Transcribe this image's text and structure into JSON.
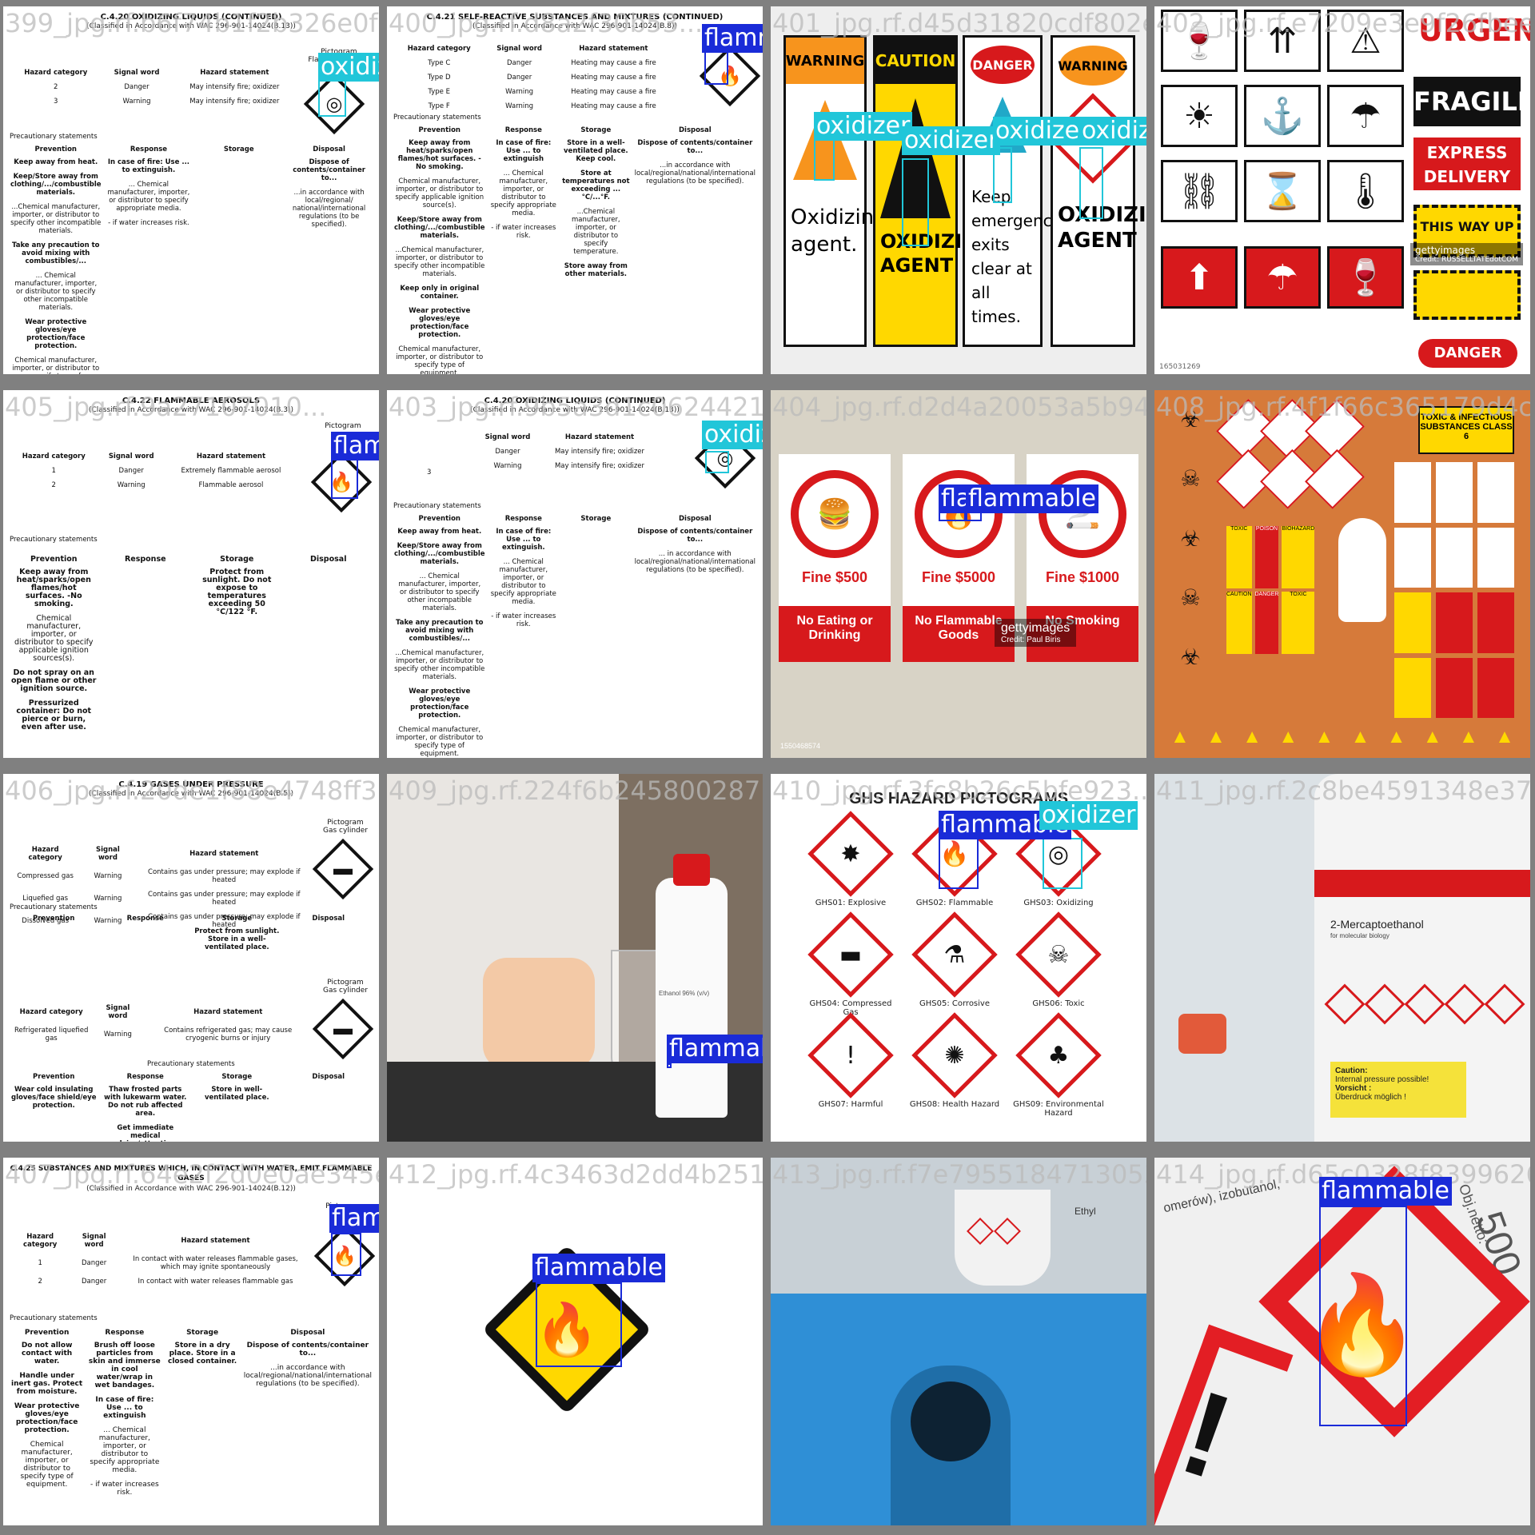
{
  "labels": {
    "flammable": "flammable",
    "oxidizer": "oxidizer"
  },
  "colors": {
    "flammable_box": "#1a2bd8",
    "oxidizer_box": "#21c6d9",
    "background": "#808080"
  },
  "tiles": {
    "t1": {
      "fname": "399_jpg.rf.b6f74b1f2b326e0f0e...",
      "title": "C.4.20 OXIDIZING LIQUIDS (CONTINUED)",
      "subtitle": "(Classified in Accordance with WAC 296-901-14024(B.13))",
      "headers": [
        "Hazard category",
        "Signal word",
        "Hazard statement"
      ],
      "rows": [
        [
          "2",
          "Danger",
          "May intensify fire; oxidizer"
        ],
        [
          "3",
          "Warning",
          "May intensify fire; oxidizer"
        ]
      ],
      "precaution_label": "Precautionary statements",
      "col_heads": [
        "Prevention",
        "Response",
        "Storage",
        "Disposal"
      ],
      "prevention": [
        "Keep away from heat.",
        "Keep/Store away from clothing/.../combustible materials.",
        "...Chemical manufacturer, importer, or distributor to specify other incompatible materials.",
        "Take any precaution to avoid mixing with combustibles/...",
        "... Chemical manufacturer, importer, or distributor to specify other incompatible materials.",
        "Wear protective gloves/eye protection/face protection.",
        "Chemical manufacturer, importer, or distributor to specify type of equipment."
      ],
      "response": [
        "In case of fire: Use ... to extinguish.",
        "... Chemical manufacturer, importer, or distributor to specify appropriate media.",
        "- if water increases risk."
      ],
      "disposal": [
        "Dispose of contents/container to...",
        "...in accordance with local/regional/ national/international regulations (to be specified)."
      ],
      "picto": "Pictogram",
      "picto_sub": "Flame over circle"
    },
    "t2": {
      "fname": "400_jpg.rf.d8a2f30b53...",
      "title": "C.4.21 SELF-REACTIVE SUBSTANCES AND MIXTURES (CONTINUED)",
      "subtitle": "(Classified in Accordance with WAC 296-901-14024(B.8))",
      "headers": [
        "Hazard category",
        "Signal word",
        "Hazard statement"
      ],
      "rows": [
        [
          "Type C",
          "Danger",
          "Heating may cause a fire"
        ],
        [
          "Type D",
          "Danger",
          "Heating may cause a fire"
        ],
        [
          "Type E",
          "Warning",
          "Heating may cause a fire"
        ],
        [
          "Type F",
          "Warning",
          "Heating may cause a fire"
        ]
      ],
      "precaution_label": "Precautionary statements",
      "col_heads": [
        "Prevention",
        "Response",
        "Storage",
        "Disposal"
      ],
      "prevention": [
        "Keep away from heat/sparks/open flames/hot surfaces. - No smoking.",
        "Chemical manufacturer, importer, or distributor to specify applicable ignition source(s).",
        "Keep/Store away from clothing/.../combustible materials.",
        "...Chemical manufacturer, importer, or distributor to specify other incompatible materials.",
        "Keep only in original container.",
        "Wear protective gloves/eye protection/face protection.",
        "Chemical manufacturer, importer, or distributor to specify type of equipment."
      ],
      "response": [
        "In case of fire: Use ... to extinguish",
        "... Chemical manufacturer, importer, or distributor to specify appropriate media.",
        "- if water increases risk."
      ],
      "storage": [
        "Store in a well-ventilated place. Keep cool.",
        "Store at temperatures not exceeding ...°C/...°F.",
        "...Chemical manufacturer, importer, or distributor to specify temperature.",
        "Store away from other materials."
      ],
      "disposal": [
        "Dispose of contents/container to...",
        "...in accordance with local/regional/national/international regulations (to be specified)."
      ]
    },
    "t3": {
      "fname": "401_jpg.rf.d45d31820cdf802e5708...",
      "signs": [
        {
          "header": "WARNING",
          "body": "Oxidizing agent."
        },
        {
          "header": "CAUTION",
          "body": "OXIDIZING AGENT"
        },
        {
          "header": "DANGER",
          "body": "Keep emergency exits clear at all times."
        },
        {
          "header": "WARNING",
          "body": "OXIDIZING AGENT"
        }
      ]
    },
    "t4": {
      "fname": "402_jpg.rf.e7209e3e9f26fbeefc3...",
      "words": [
        "URGENT",
        "FRAGILE",
        "EXPRESS DELIVERY",
        "THIS WAY UP",
        "DANGER",
        "THIS WAY UP"
      ],
      "watermark": "gettyimages",
      "credit": "Credit: RUSSELLTATEdotCOM",
      "stock_id": "165031269"
    },
    "t5": {
      "fname": "405_jpg.rf.9a27107010...",
      "title": "C.4.22 FLAMMABLE AEROSOLS",
      "subtitle": "(Classified in Accordance with WAC 296-901-14024(B.3))",
      "headers": [
        "Hazard category",
        "Signal word",
        "Hazard statement"
      ],
      "rows": [
        [
          "1",
          "Danger",
          "Extremely flammable aerosol"
        ],
        [
          "2",
          "Warning",
          "Flammable aerosol"
        ]
      ],
      "picto": "Pictogram",
      "precaution_label": "Precautionary statements",
      "col_heads": [
        "Prevention",
        "Response",
        "Storage",
        "Disposal"
      ],
      "prevention": [
        "Keep away from heat/sparks/open flames/hot surfaces. -No smoking.",
        "Chemical manufacturer, importer, or distributor to specify applicable ignition sources(s).",
        "Do not spray on an open flame or other ignition source.",
        "Pressurized container: Do not pierce or burn, even after use."
      ],
      "storage": [
        "Protect from sunlight. Do not expose to temperatures exceeding 50 °C/122 °F."
      ]
    },
    "t6": {
      "fname": "403_jpg.rf.9b5a3d1c0624421c2...",
      "title": "C.4.20 OXIDIZING LIQUIDS (CONTINUED)",
      "subtitle": "(Classified in Accordance with WAC 296-901-14024(B.13))",
      "headers": [
        "Signal word",
        "Hazard statement"
      ],
      "rows": [
        [
          "Danger",
          "May intensify fire; oxidizer"
        ],
        [
          "Warning",
          "May intensify fire; oxidizer"
        ]
      ],
      "row_cat": "3",
      "precaution_label": "Precautionary statements",
      "col_heads": [
        "Prevention",
        "Response",
        "Storage",
        "Disposal"
      ],
      "prevention": [
        "Keep away from heat.",
        "Keep/Store away from clothing/.../combustible materials.",
        "... Chemical manufacturer, importer, or distributor to specify other incompatible materials.",
        "Take any precaution to avoid mixing with combustibles/...",
        "...Chemical manufacturer, importer, or distributor to specify other incompatible materials.",
        "Wear protective gloves/eye protection/face protection.",
        "Chemical manufacturer, importer, or distributor to specify type of equipment."
      ],
      "response": [
        "In case of fire: Use ... to extinguish.",
        "... Chemical manufacturer, importer, or distributor to specify appropriate media.",
        "- if water increases risk."
      ],
      "disposal": [
        "Dispose of contents/container to...",
        "... in accordance with local/regional/national/international regulations (to be specified)."
      ]
    },
    "t7": {
      "fname": "404_jpg.rf.d2d4a20053a5b94c5b0...",
      "fines": [
        "Fine $500",
        "Fine $5000",
        "Fine $1000"
      ],
      "notices": [
        "No Eating or Drinking",
        "No Flammable Goods",
        "No Smoking"
      ],
      "watermark": "gettyimages",
      "credit": "Credit: Paul Biris",
      "stock_id": "1550468574"
    },
    "t8": {
      "fname": "408_jpg.rf.4f1f66c365179d4c...",
      "poster_title": "TOXIC & INFECTIOUS SUBSTANCES CLASS 6",
      "tags": [
        "TOXIC",
        "POISON",
        "BIOHAZARD",
        "CAUTION",
        "DANGER"
      ]
    },
    "t9": {
      "fname": "406_jpg.rf.20de1f88e4748ff3...",
      "title": "C.4.19 GASES UNDER PRESSURE",
      "subtitle": "(Classified in Accordance with WAC 296-901-14024(B.5))",
      "picto": "Pictogram",
      "picto_sub": "Gas cylinder",
      "headers": [
        "Hazard category",
        "Signal word",
        "Hazard statement"
      ],
      "rows": [
        [
          "Compressed gas",
          "Warning",
          "Contains gas under pressure; may explode if heated"
        ],
        [
          "Liquefied gas",
          "Warning",
          "Contains gas under pressure; may explode if heated"
        ],
        [
          "Dissolved gas",
          "Warning",
          "Contains gas under pressure; may explode if heated"
        ]
      ],
      "precaution_label": "Precautionary statements",
      "col_heads": [
        "Prevention",
        "Response",
        "Storage",
        "Disposal"
      ],
      "storage1": "Protect from sunlight. Store in a well-ventilated place.",
      "headers2": [
        "Hazard category",
        "Signal word",
        "Hazard statement"
      ],
      "rows2": [
        [
          "Refrigerated liquefied gas",
          "Warning",
          "Contains refrigerated gas; may cause cryogenic burns or injury"
        ]
      ],
      "prevention2": "Wear cold insulating gloves/face shield/eye protection.",
      "response2": "Thaw frosted parts with lukewarm water. Do not rub affected area.",
      "response2b": "Get immediate medical advice/attention.",
      "storage2": "Store in well-ventilated place."
    },
    "t10": {
      "fname": "409_jpg.rf.224f6b2458002871...",
      "bottle_label": "Ethanol 96% (v/v)"
    },
    "t11": {
      "fname": "410_jpg.rf.3fc8b26c5bfe923...",
      "title": "GHS HAZARD PICTOGRAMS",
      "cells": [
        {
          "label": "GHS01: Explosive",
          "glyph": "✸"
        },
        {
          "label": "GHS02: Flammable",
          "glyph": "🔥"
        },
        {
          "label": "GHS03: Oxidizing",
          "glyph": "◎"
        },
        {
          "label": "GHS04: Compressed Gas",
          "glyph": "▬"
        },
        {
          "label": "GHS05: Corrosive",
          "glyph": "⚗"
        },
        {
          "label": "GHS06: Toxic",
          "glyph": "☠"
        },
        {
          "label": "GHS07: Harmful",
          "glyph": "!"
        },
        {
          "label": "GHS08: Health Hazard",
          "glyph": "✺"
        },
        {
          "label": "GHS09: Environmental Hazard",
          "glyph": "♣"
        }
      ]
    },
    "t12": {
      "fname": "411_jpg.rf.2c8be4591348e37d...",
      "product": "2-Mercaptoethanol",
      "product_sub": "for molecular biology",
      "caution": "Caution:",
      "caution_en": "Internal pressure possible!",
      "vorsicht": "Vorsicht :",
      "caution_de": "Überdruck möglich !"
    },
    "t13": {
      "fname": "407_jpg.rf.64e2f2d0e0ae345e...",
      "title": "C.4.25 SUBSTANCES AND MIXTURES WHICH, IN CONTACT WITH WATER, EMIT FLAMMABLE GASES",
      "subtitle": "(Classified in Accordance with WAC 296-901-14024(B.12))",
      "picto": "Pictogram",
      "headers": [
        "Hazard category",
        "Signal word",
        "Hazard statement"
      ],
      "rows": [
        [
          "1",
          "Danger",
          "In contact with water releases flammable gases, which may ignite spontaneously"
        ],
        [
          "2",
          "Danger",
          "In contact with water releases flammable gas"
        ]
      ],
      "precaution_label": "Precautionary statements",
      "col_heads": [
        "Prevention",
        "Response",
        "Storage",
        "Disposal"
      ],
      "prevention": [
        "Do not allow contact with water.",
        "Handle under inert gas. Protect from moisture.",
        "Wear protective gloves/eye protection/face protection.",
        "Chemical manufacturer, importer, or distributor to specify type of equipment."
      ],
      "response": [
        "Brush off loose particles from skin and immerse in cool water/wrap in wet bandages.",
        "In case of fire: Use ... to extinguish",
        "... Chemical manufacturer, importer, or distributor to specify appropriate media.",
        "- if water increases risk."
      ],
      "storage": [
        "Store in a dry place. Store in a closed container."
      ],
      "disposal": [
        "Dispose of contents/container to...",
        "...in accordance with local/regional/national/international regulations (to be specified)."
      ]
    },
    "t14": {
      "fname": "412_jpg.rf.4c3463d2dd4b251b..."
    },
    "t15": {
      "fname": "413_jpg.rf.f7e7955184713053a...",
      "bottle_text": "Ethyl"
    },
    "t16": {
      "fname": "414_jpg.rf.d65c0328f8399626...",
      "label_text": "omerów), izobutanol,",
      "net": "Obj.netto:",
      "num": "500"
    }
  }
}
